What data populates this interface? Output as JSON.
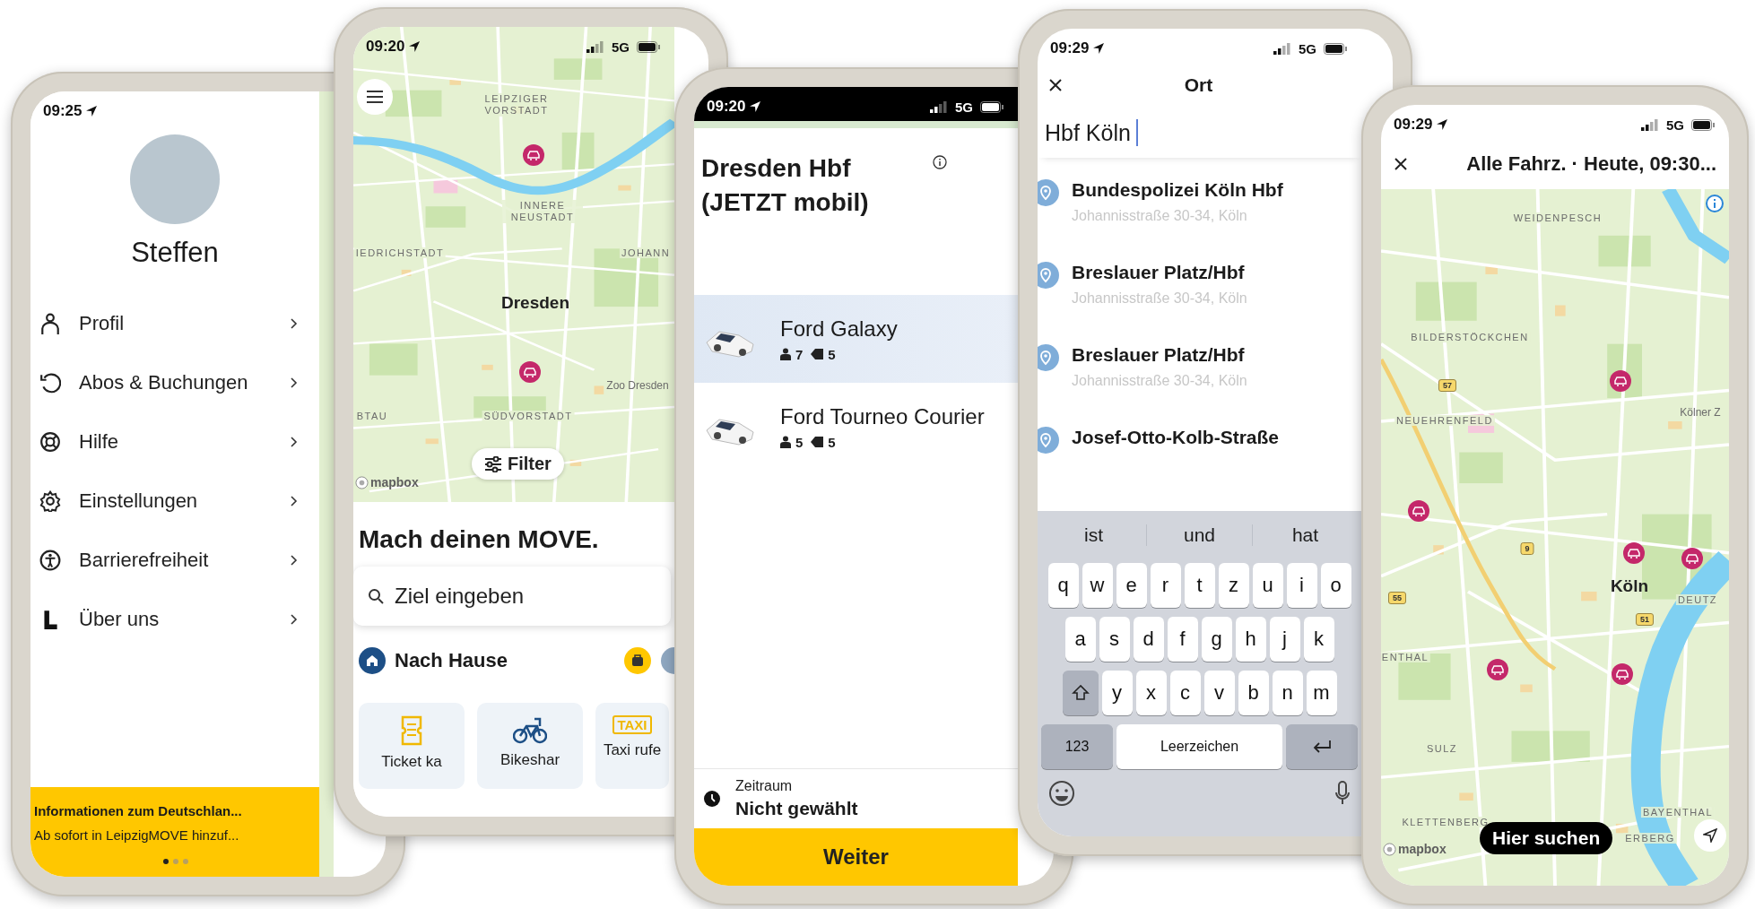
{
  "screens": [
    {
      "kind": "menu",
      "status": {
        "time": "09:25"
      },
      "user": {
        "name": "Steffen"
      },
      "menu": [
        {
          "label": "Profil",
          "kind": "person"
        },
        {
          "label": "Abos & Buchungen",
          "kind": "history"
        },
        {
          "label": "Hilfe",
          "kind": "help"
        },
        {
          "label": "Einstellungen",
          "kind": "settings"
        },
        {
          "label": "Barrierefreiheit",
          "kind": "accessibility"
        },
        {
          "label": "Über uns",
          "kind": "about"
        }
      ],
      "banner": {
        "title": "Informationen zum Deutschlan...",
        "text": "Ab sofort in LeipzigMOVE hinzuf...",
        "pages": [
          {
            "selected": true
          },
          {
            "selected": false
          },
          {
            "selected": false
          }
        ]
      }
    },
    {
      "kind": "home",
      "status": {
        "time": "09:20",
        "network": "5G"
      },
      "map": {
        "labels": [
          {
            "text": "LEIPZIGER VORSTADT",
            "kind": "district"
          },
          {
            "text": "INNERE NEUSTADT",
            "kind": "district"
          },
          {
            "text": "IEDRICHSTADT",
            "kind": "district"
          },
          {
            "text": "JOHANN",
            "kind": "district"
          },
          {
            "text": "Dresden",
            "kind": "city"
          },
          {
            "text": "Zoo Dresden",
            "kind": "poi"
          },
          {
            "text": "BTAU",
            "kind": "district"
          },
          {
            "text": "SÜDVORSTADT",
            "kind": "district"
          }
        ]
      },
      "filter": "Filter",
      "attribution": "mapbox",
      "headline": "Mach deinen MOVE.",
      "search": {
        "placeholder": "Ziel eingeben"
      },
      "shortcut": "Nach Hause",
      "tiles": [
        {
          "label": "Ticket ka",
          "kind": "ticket"
        },
        {
          "label": "Bikeshar",
          "kind": "bike"
        },
        {
          "label": "Taxi rufe",
          "kind": "taxi",
          "icon_text": "TAXI"
        }
      ]
    },
    {
      "kind": "station",
      "status": {
        "time": "09:20",
        "network": "5G"
      },
      "title": "Dresden Hbf (JETZT mobil)",
      "vehicles": [
        {
          "name": "Ford Galaxy",
          "seats": "7",
          "bags": "5",
          "selected": true
        },
        {
          "name": "Ford Tourneo Courier",
          "seats": "5",
          "bags": "5",
          "selected": false
        }
      ],
      "period": {
        "label": "Zeitraum",
        "value": "Nicht gewählt"
      },
      "button": "Weiter"
    },
    {
      "kind": "search",
      "status": {
        "time": "09:29",
        "network": "5G"
      },
      "title": "Ort",
      "query": "Hbf Köln",
      "results": [
        {
          "name": "Bundespolizei Köln Hbf",
          "address": "Johannisstraße 30-34, Köln"
        },
        {
          "name": "Breslauer Platz/Hbf",
          "address": "Johannisstraße 30-34, Köln"
        },
        {
          "name": "Breslauer Platz/Hbf",
          "address": "Johannisstraße 30-34, Köln"
        },
        {
          "name": "Josef-Otto-Kolb-Straße"
        }
      ],
      "keyboard": {
        "suggestions": [
          "ist",
          "und",
          "hat"
        ],
        "rows": [
          [
            "q",
            "w",
            "e",
            "r",
            "t",
            "z",
            "u",
            "i",
            "o"
          ],
          [
            "a",
            "s",
            "d",
            "f",
            "g",
            "h",
            "j",
            "k"
          ],
          [
            "y",
            "x",
            "c",
            "v",
            "b",
            "n",
            "m"
          ]
        ],
        "mode_key": "123",
        "space_key": "Leerzeichen"
      }
    },
    {
      "kind": "map",
      "status": {
        "time": "09:29",
        "network": "5G"
      },
      "filter_summary": "Alle Fahrz. · Heute, 09:30...",
      "map": {
        "labels": [
          {
            "text": "WEIDENPESCH",
            "kind": "district"
          },
          {
            "text": "BILDERSTÖCKCHEN",
            "kind": "district"
          },
          {
            "text": "NEUEHRENFELD",
            "kind": "district"
          },
          {
            "text": "Kölner Z",
            "kind": "poi"
          },
          {
            "text": "57",
            "kind": "shield"
          },
          {
            "text": "9",
            "kind": "shield"
          },
          {
            "text": "Köln",
            "kind": "city"
          },
          {
            "text": "DEUTZ",
            "kind": "district"
          },
          {
            "text": "55",
            "kind": "shield"
          },
          {
            "text": "51",
            "kind": "shield"
          },
          {
            "text": "ENTHAL",
            "kind": "district"
          },
          {
            "text": "SULZ",
            "kind": "district"
          },
          {
            "text": "BAYENTHAL",
            "kind": "district"
          },
          {
            "text": "KLETTENBERG",
            "kind": "district"
          },
          {
            "text": "ERBERG",
            "kind": "district"
          }
        ]
      },
      "attribution": "mapbox",
      "search_button": "Hier suchen"
    }
  ]
}
